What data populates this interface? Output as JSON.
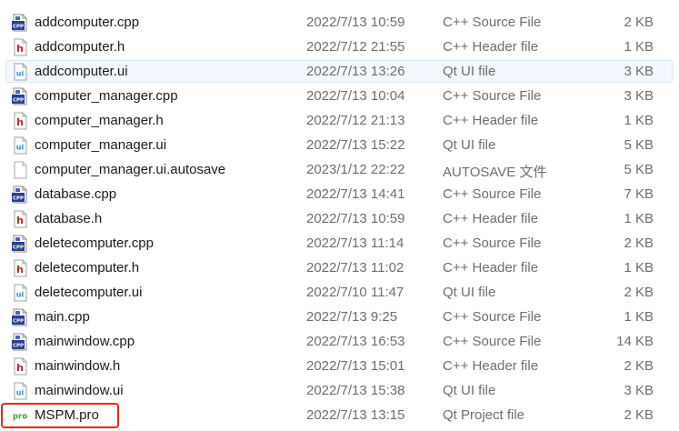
{
  "files": [
    {
      "name": "addcomputer.cpp",
      "date": "2022/7/13 10:59",
      "type": "C++ Source File",
      "size": "2 KB",
      "icon": "cpp-file-icon"
    },
    {
      "name": "addcomputer.h",
      "date": "2022/7/12 21:55",
      "type": "C++ Header file",
      "size": "1 KB",
      "icon": "header-file-icon"
    },
    {
      "name": "addcomputer.ui",
      "date": "2022/7/13 13:26",
      "type": "Qt UI file",
      "size": "3 KB",
      "icon": "ui-file-icon"
    },
    {
      "name": "computer_manager.cpp",
      "date": "2022/7/13 10:04",
      "type": "C++ Source File",
      "size": "3 KB",
      "icon": "cpp-file-icon"
    },
    {
      "name": "computer_manager.h",
      "date": "2022/7/12 21:13",
      "type": "C++ Header file",
      "size": "1 KB",
      "icon": "header-file-icon"
    },
    {
      "name": "computer_manager.ui",
      "date": "2022/7/13 15:22",
      "type": "Qt UI file",
      "size": "5 KB",
      "icon": "ui-file-icon"
    },
    {
      "name": "computer_manager.ui.autosave",
      "date": "2023/1/12 22:22",
      "type": "AUTOSAVE 文件",
      "size": "5 KB",
      "icon": "blank-file-icon"
    },
    {
      "name": "database.cpp",
      "date": "2022/7/13 14:41",
      "type": "C++ Source File",
      "size": "7 KB",
      "icon": "cpp-file-icon"
    },
    {
      "name": "database.h",
      "date": "2022/7/13 10:59",
      "type": "C++ Header file",
      "size": "1 KB",
      "icon": "header-file-icon"
    },
    {
      "name": "deletecomputer.cpp",
      "date": "2022/7/13 11:14",
      "type": "C++ Source File",
      "size": "2 KB",
      "icon": "cpp-file-icon"
    },
    {
      "name": "deletecomputer.h",
      "date": "2022/7/13 11:02",
      "type": "C++ Header file",
      "size": "1 KB",
      "icon": "header-file-icon"
    },
    {
      "name": "deletecomputer.ui",
      "date": "2022/7/10 11:47",
      "type": "Qt UI file",
      "size": "2 KB",
      "icon": "ui-file-icon"
    },
    {
      "name": "main.cpp",
      "date": "2022/7/13 9:25",
      "type": "C++ Source File",
      "size": "1 KB",
      "icon": "cpp-file-icon"
    },
    {
      "name": "mainwindow.cpp",
      "date": "2022/7/13 16:53",
      "type": "C++ Source File",
      "size": "14 KB",
      "icon": "cpp-file-icon"
    },
    {
      "name": "mainwindow.h",
      "date": "2022/7/13 15:01",
      "type": "C++ Header file",
      "size": "2 KB",
      "icon": "header-file-icon"
    },
    {
      "name": "mainwindow.ui",
      "date": "2022/7/13 15:38",
      "type": "Qt UI file",
      "size": "3 KB",
      "icon": "ui-file-icon"
    },
    {
      "name": "MSPM.pro",
      "date": "2022/7/13 13:15",
      "type": "Qt Project file",
      "size": "2 KB",
      "icon": "pro-file-icon"
    }
  ],
  "hovered_index": 2,
  "highlighted_index": 16,
  "colors": {
    "hover_background": "#f2f8fd",
    "hover_border": "#d6e8f7",
    "highlight_border": "#e8262a",
    "secondary_text": "#6d6d6d"
  }
}
